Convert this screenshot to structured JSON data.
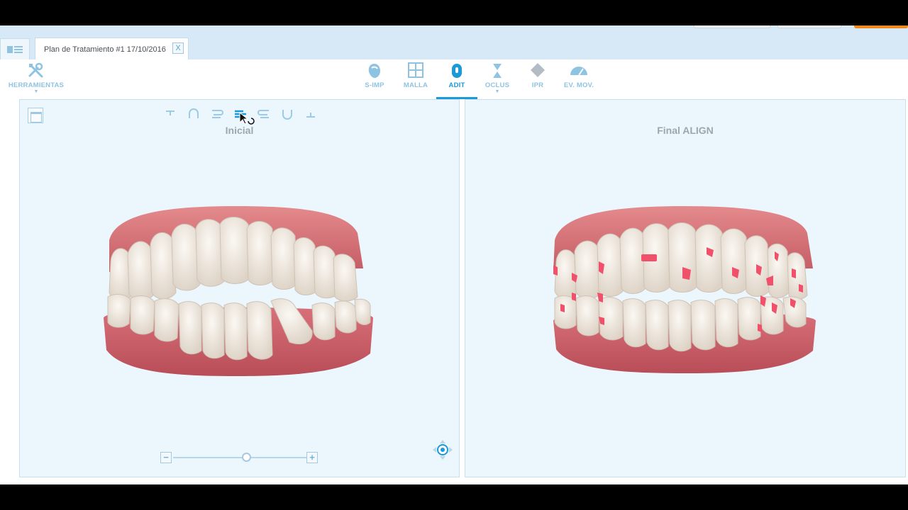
{
  "tab": {
    "label": "Plan de Tratamiento #1 17/10/2016",
    "close_label": "X"
  },
  "toolbar": {
    "tools_label": "HERRAMIENTAS",
    "items": [
      {
        "label": "S-IMP",
        "icon": "tooth-outline-icon"
      },
      {
        "label": "MALLA",
        "icon": "grid-icon"
      },
      {
        "label": "ADIT",
        "icon": "attachment-icon"
      },
      {
        "label": "OCLUS",
        "icon": "occlusion-icon"
      },
      {
        "label": "IPR",
        "icon": "diamond-icon"
      },
      {
        "label": "EV. MOV.",
        "icon": "gauge-icon"
      }
    ],
    "active": "ADIT"
  },
  "left_view": {
    "title": "Inicial",
    "jaw_view_icons": [
      "upper-view-icon",
      "arch-upper-icon",
      "right-view-icon",
      "front-view-icon",
      "left-view-icon",
      "arch-lower-icon",
      "lower-view-icon"
    ],
    "zoom_minus": "−",
    "zoom_plus": "+",
    "zoom_level": 0.55
  },
  "right_view": {
    "title": "Final ALIGN"
  },
  "colors": {
    "accent": "#1a9ad8",
    "icon_light": "#8fc3e2",
    "viewport_bg": "#ecf6fd",
    "gum": "#d9767b",
    "tooth": "#f2ece4",
    "attachment": "#f0506a"
  }
}
